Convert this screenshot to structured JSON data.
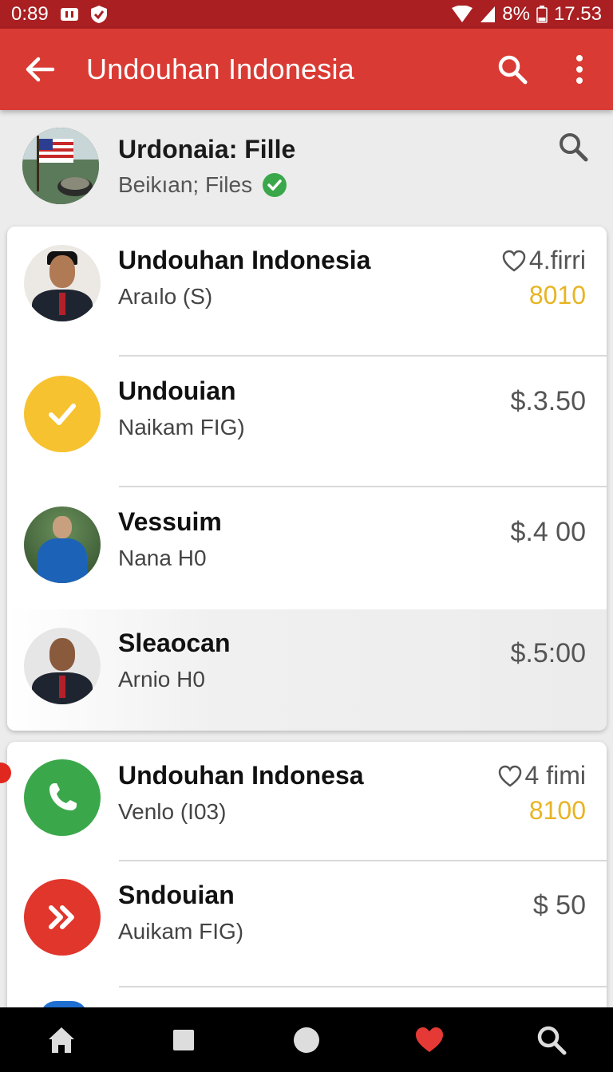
{
  "status_bar": {
    "time_left": "0:89",
    "battery": "8%",
    "clock": "17.53"
  },
  "app_bar": {
    "title": "Undouhan Indonesia",
    "icons": [
      "back-arrow-icon",
      "search-icon",
      "more-vert-icon"
    ]
  },
  "profile": {
    "name": "Urdonaia: Fille",
    "subtitle": "Beikıan; Files",
    "verified_color": "#3aa84a"
  },
  "card1": {
    "rows": [
      {
        "title": "Undouhan Indonesia",
        "subtitle": "Araılo (S)",
        "meta": "4.firri",
        "value": "8010"
      },
      {
        "title": "Undouian",
        "subtitle": "Naikam FIG)",
        "price": "$.3.50"
      },
      {
        "title": "Vessuim",
        "subtitle": "Nana H0",
        "price": "$.4 00"
      },
      {
        "title": "Sleaocan",
        "subtitle": "Arnio H0",
        "price": "$.5:00"
      }
    ]
  },
  "card2": {
    "rows": [
      {
        "title": "Undouhan Indonesa",
        "subtitle": "Venlo (I03)",
        "meta": "4 fimi",
        "value": "8100"
      },
      {
        "title": "Sndouian",
        "subtitle": "Auikam FIG)",
        "price": "$ 50"
      }
    ]
  },
  "colors": {
    "app_bar": "#d93b34",
    "status_bar": "#a91f22",
    "accent_value": "#e8b423",
    "check_circle": "#f7c230",
    "phone_circle": "#3aa84a",
    "forward_circle": "#e0362c",
    "nav_heart": "#e53935"
  },
  "nav_bar": {
    "icons": [
      "home-icon",
      "square-icon",
      "circle-icon",
      "heart-icon",
      "search-icon"
    ]
  }
}
